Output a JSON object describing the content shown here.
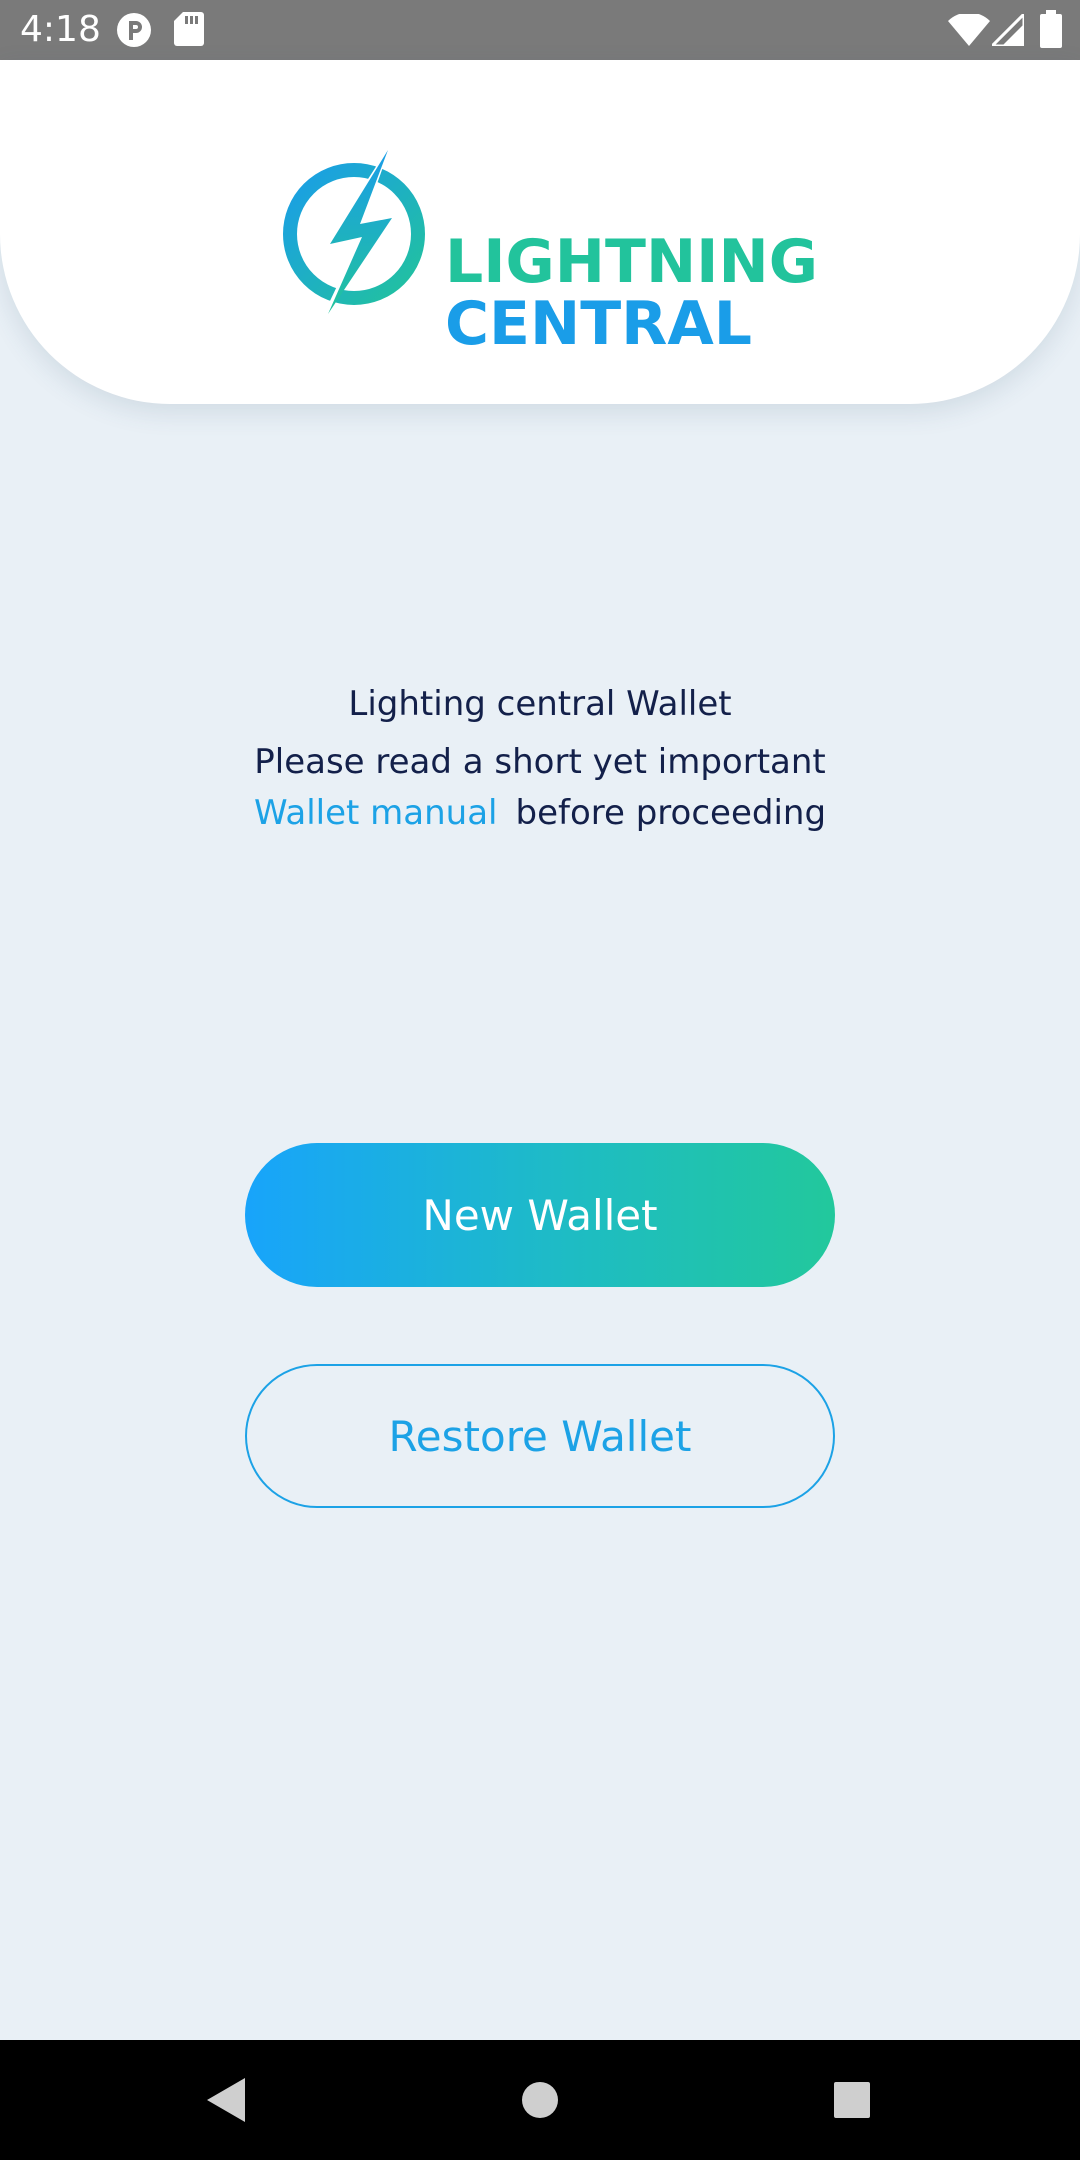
{
  "status_bar": {
    "time": "4:18",
    "left_icons": [
      "account-circle-icon",
      "sd-card-icon"
    ],
    "right_icons": [
      "wifi-icon",
      "cell-signal-icon",
      "battery-icon"
    ]
  },
  "header": {
    "logo_line1": "LIGHTNING",
    "logo_line2": "CENTRAL",
    "logo_icon": "lightning-bolt-icon"
  },
  "intro": {
    "title": "Lighting central Wallet",
    "line2": "Please read a short yet important",
    "link": "Wallet manual",
    "line3_rest": "before proceeding"
  },
  "buttons": {
    "new_wallet": "New Wallet",
    "restore_wallet": "Restore Wallet"
  },
  "nav_bar": {
    "icons": [
      "back-icon",
      "home-icon",
      "recents-icon"
    ]
  },
  "colors": {
    "background": "#e9f0f6",
    "text_dark": "#13204a",
    "accent_blue": "#1ca2e6",
    "accent_green": "#22c89c",
    "status_bar": "#7a7a7a"
  }
}
